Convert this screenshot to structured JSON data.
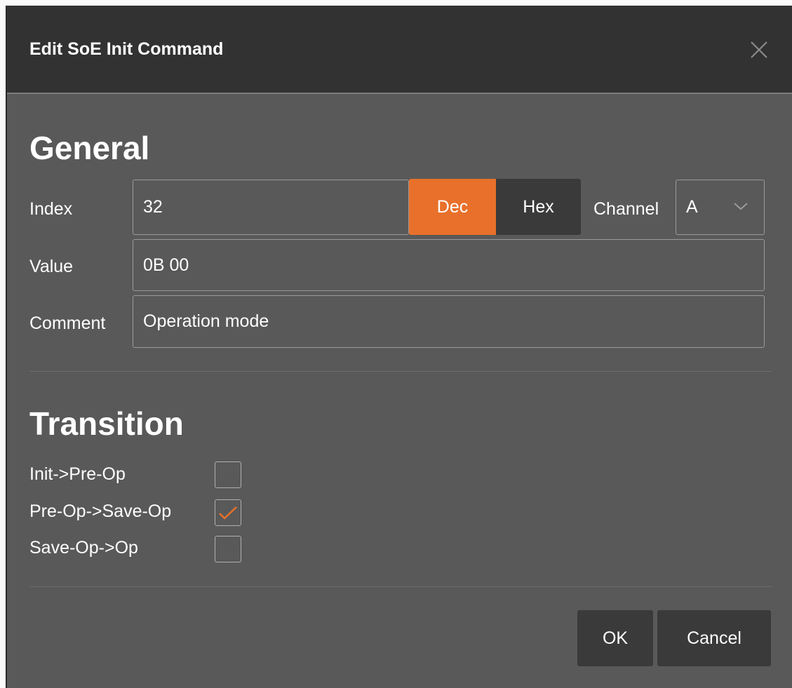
{
  "dialog": {
    "title": "Edit SoE Init Command",
    "close_icon": "close-icon"
  },
  "general": {
    "heading": "General",
    "index_label": "Index",
    "index_value": "32",
    "dec_label": "Dec",
    "hex_label": "Hex",
    "base_selected": "Dec",
    "channel_label": "Channel",
    "channel_value": "A",
    "value_label": "Value",
    "value_value": "0B 00",
    "comment_label": "Comment",
    "comment_value": "Operation mode"
  },
  "transition": {
    "heading": "Transition",
    "items": [
      {
        "label": "Init->Pre-Op",
        "checked": false
      },
      {
        "label": "Pre-Op->Save-Op",
        "checked": true
      },
      {
        "label": "Save-Op->Op",
        "checked": false
      }
    ]
  },
  "footer": {
    "ok_label": "OK",
    "cancel_label": "Cancel"
  },
  "colors": {
    "accent": "#e8702a",
    "titlebar": "#323232",
    "panel": "#595959"
  }
}
